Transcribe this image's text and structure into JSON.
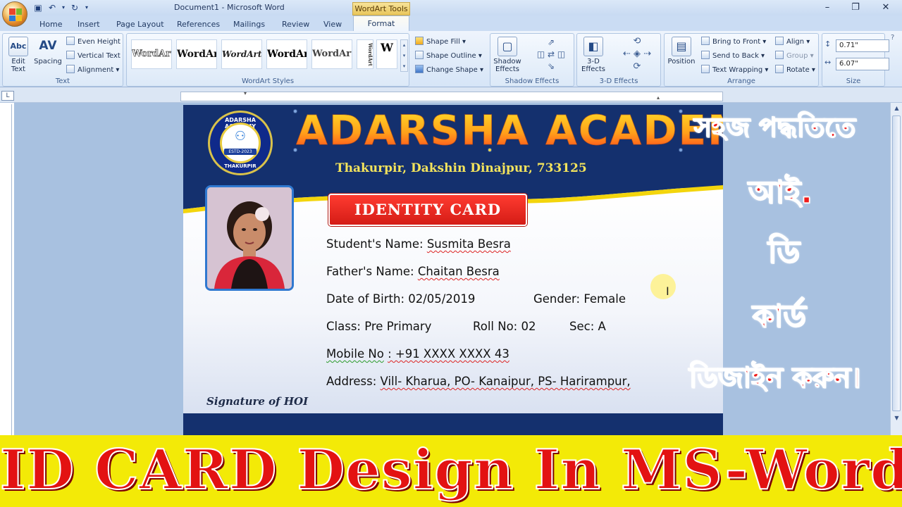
{
  "window": {
    "title": "Document1 - Microsoft Word",
    "contextual_tab_title": "WordArt Tools",
    "controls": {
      "minimize": "–",
      "restore": "❐",
      "close": "✕"
    }
  },
  "tabs": [
    "Home",
    "Insert",
    "Page Layout",
    "References",
    "Mailings",
    "Review",
    "View",
    "Format"
  ],
  "ribbon": {
    "text_group": {
      "label": "Text",
      "edit_text": "Edit Text",
      "spacing": "Spacing",
      "even_height": "Even Height",
      "vertical_text": "Vertical Text",
      "alignment": "Alignment"
    },
    "wordart_styles": {
      "label": "WordArt Styles",
      "samples": [
        "WordArt",
        "WordArt",
        "WordArt",
        "WordArt",
        "WordArt",
        "WordArt",
        "W"
      ]
    },
    "shape_group": {
      "fill": "Shape Fill",
      "outline": "Shape Outline",
      "change": "Change Shape"
    },
    "shadow": {
      "button": "Shadow Effects",
      "label": "Shadow Effects"
    },
    "threed": {
      "button": "3-D Effects",
      "label": "3-D Effects"
    },
    "arrange": {
      "label": "Arrange",
      "position": "Position",
      "bring_front": "Bring to Front",
      "send_back": "Send to Back",
      "text_wrapping": "Text Wrapping",
      "align": "Align",
      "group": "Group",
      "rotate": "Rotate"
    },
    "size": {
      "label": "Size",
      "height": "0.71\"",
      "width": "6.07\""
    }
  },
  "card": {
    "seal_name": "ADARSHA ACADEMY",
    "seal_estd": "ESTD-2023",
    "seal_place": "THAKURPIR",
    "title": "ADARSHA ACADEMY",
    "address": "Thakurpir, Dakshin Dinajpur, 733125",
    "badge": "IDENTITY CARD",
    "fields": {
      "student_label": "Student's Name:",
      "student_value": "Susmita Besra",
      "father_label": "Father's Name:",
      "father_value": "Chaitan Besra",
      "dob": "Date of Birth: 02/05/2019",
      "gender": "Gender: Female",
      "class": "Class: Pre Primary",
      "roll": "Roll No: 02",
      "sec": "Sec: A",
      "mobile_label": "Mobile No",
      "mobile_value": ": +91 XXXX XXXX 43",
      "address_label": "Address:",
      "address_value": "Vill- Kharua, PO- Kanaipur, PS- Harirampur,"
    },
    "signature": "Signature of HOI"
  },
  "overlay_bengali": [
    "সহজ পদ্ধতিতে",
    "আই.",
    "ডি",
    "কার্ড",
    "ডিজাইন করুন।"
  ],
  "banner": "ID CARD Design In MS-Word"
}
